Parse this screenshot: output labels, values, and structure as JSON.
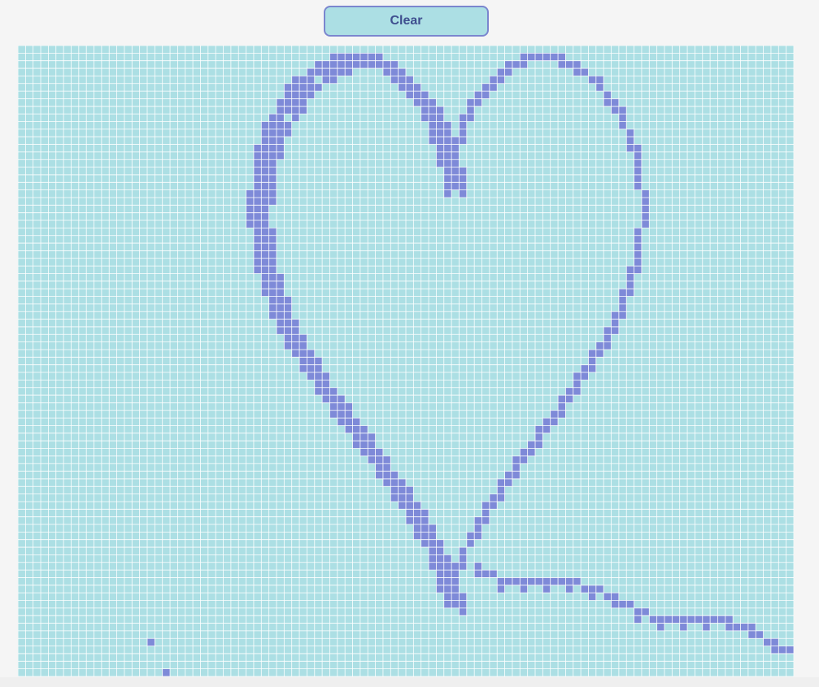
{
  "toolbar": {
    "clear_label": "Clear"
  },
  "grid": {
    "columns": 102,
    "rows": 83,
    "empty_color": "#acdfe4",
    "line_color": "#ffffff",
    "fill_color": "#7e8ad8",
    "drawing": "heart"
  }
}
